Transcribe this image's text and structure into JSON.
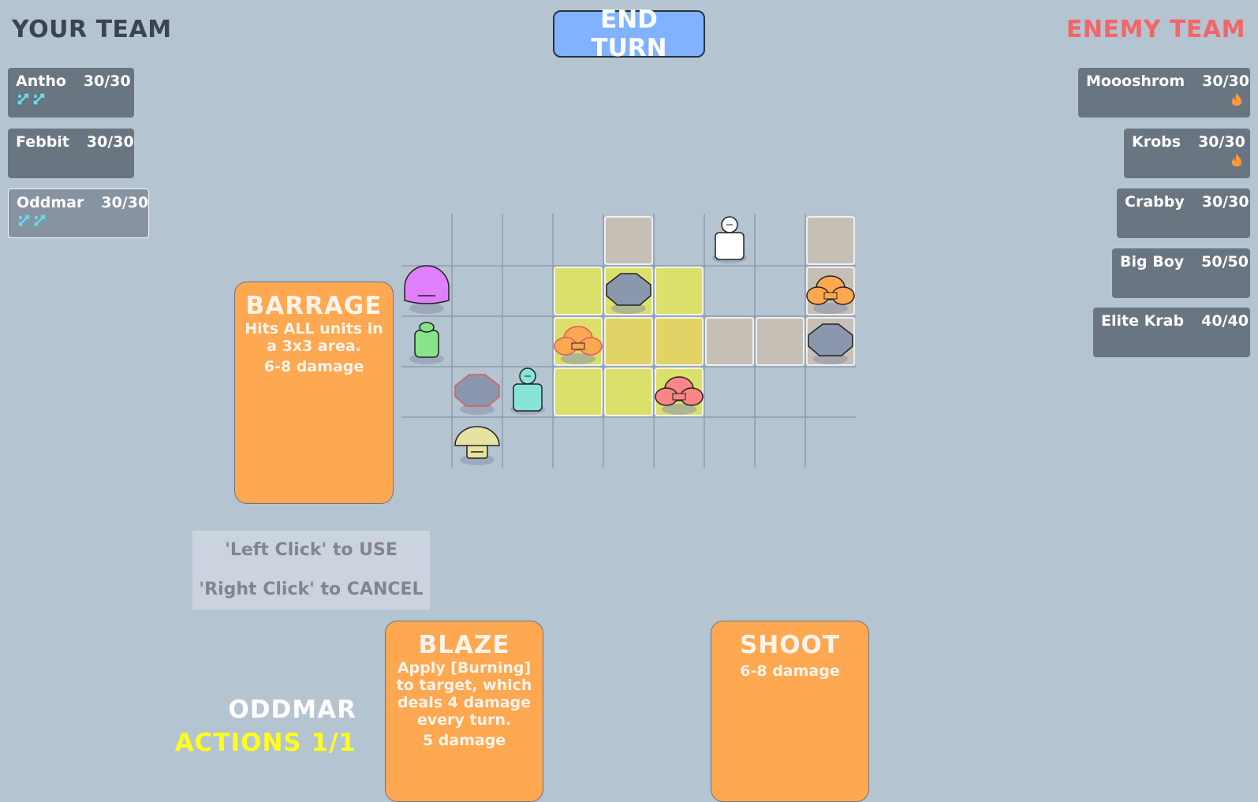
{
  "your_team": {
    "title": "YOUR TEAM",
    "units": [
      {
        "name": "Antho",
        "hp": "30/30",
        "statuses": [
          "sword-buff-icon",
          "sword-buff-icon"
        ],
        "selected": false
      },
      {
        "name": "Febbit",
        "hp": "30/30",
        "statuses": [],
        "selected": false
      },
      {
        "name": "Oddmar",
        "hp": "30/30",
        "statuses": [
          "sword-buff-icon",
          "sword-buff-icon"
        ],
        "selected": true
      }
    ]
  },
  "enemy_team": {
    "title": "ENEMY TEAM",
    "units": [
      {
        "name": "Moooshrom",
        "hp": "30/30",
        "statuses": [
          "burning-icon"
        ]
      },
      {
        "name": "Krobs",
        "hp": "30/30",
        "statuses": [
          "burning-icon"
        ]
      },
      {
        "name": "Crabby",
        "hp": "30/30",
        "statuses": []
      },
      {
        "name": "Big Boy",
        "hp": "50/50",
        "statuses": []
      },
      {
        "name": "Elite Krab",
        "hp": "40/40",
        "statuses": []
      }
    ]
  },
  "end_turn_label": "END TURN",
  "grid": {
    "cols": 9,
    "rows": 5,
    "tiles": [
      {
        "col": 4,
        "row": 0,
        "type": "blocked"
      },
      {
        "col": 8,
        "row": 0,
        "type": "blocked"
      },
      {
        "col": 3,
        "row": 1,
        "type": "target-area"
      },
      {
        "col": 4,
        "row": 1,
        "type": "target-area"
      },
      {
        "col": 5,
        "row": 1,
        "type": "target-area"
      },
      {
        "col": 8,
        "row": 1,
        "type": "blocked"
      },
      {
        "col": 3,
        "row": 2,
        "type": "target-area"
      },
      {
        "col": 4,
        "row": 2,
        "type": "target-center"
      },
      {
        "col": 5,
        "row": 2,
        "type": "target-center"
      },
      {
        "col": 6,
        "row": 2,
        "type": "blocked"
      },
      {
        "col": 7,
        "row": 2,
        "type": "blocked"
      },
      {
        "col": 8,
        "row": 2,
        "type": "blocked"
      },
      {
        "col": 3,
        "row": 3,
        "type": "target-area"
      },
      {
        "col": 4,
        "row": 3,
        "type": "target-area"
      },
      {
        "col": 5,
        "row": 3,
        "type": "target-area"
      }
    ],
    "units": [
      {
        "kind": "human-white",
        "col": 6,
        "row": 0,
        "label": "selected-player-unit"
      },
      {
        "kind": "blob-purple",
        "col": 0,
        "row": 1,
        "label": "big-boy-enemy"
      },
      {
        "kind": "rock",
        "col": 4,
        "row": 1,
        "label": "rock-obstacle"
      },
      {
        "kind": "crab-orange",
        "col": 8,
        "row": 1,
        "label": "crab-enemy"
      },
      {
        "kind": "frog-green",
        "col": 0,
        "row": 2,
        "label": "frog-ally"
      },
      {
        "kind": "crab-orange",
        "col": 3,
        "row": 2,
        "label": "crab-enemy",
        "outline": "red"
      },
      {
        "kind": "rock",
        "col": 8,
        "row": 2,
        "label": "rock-obstacle"
      },
      {
        "kind": "rock",
        "col": 1,
        "row": 3,
        "label": "rock-obstacle",
        "outline": "red"
      },
      {
        "kind": "human-cyan",
        "col": 2,
        "row": 3,
        "label": "human-ally"
      },
      {
        "kind": "crab-pink",
        "col": 5,
        "row": 3,
        "label": "elite-crab-enemy"
      },
      {
        "kind": "mushroom",
        "col": 1,
        "row": 4,
        "label": "mushroom-enemy"
      }
    ]
  },
  "abilities": {
    "selected": {
      "name": "BARRAGE",
      "desc": "Hits ALL units in a 3x3 area.",
      "dmg": "6-8 damage"
    },
    "hand": [
      {
        "name": "BLAZE",
        "desc": "Apply [Burning] to target, which deals 4 damage every turn.",
        "dmg": "5 damage"
      },
      {
        "name": "SHOOT",
        "desc": "",
        "dmg": "6-8 damage"
      }
    ]
  },
  "hint": {
    "line1": "'Left Click' to USE",
    "line2": "'Right Click' to CANCEL"
  },
  "active_unit": {
    "name": "ODDMAR",
    "actions_label": "ACTIONS  1/1"
  },
  "colors": {
    "background": "#b5c4d1",
    "card_orange": "#ffa852",
    "end_turn_blue": "#80b2ff",
    "enemy_red": "#f36568",
    "actions_yellow": "#ffff1a",
    "buff_cyan": "#5ee0f0",
    "burn_orange": "#ff9a40"
  }
}
